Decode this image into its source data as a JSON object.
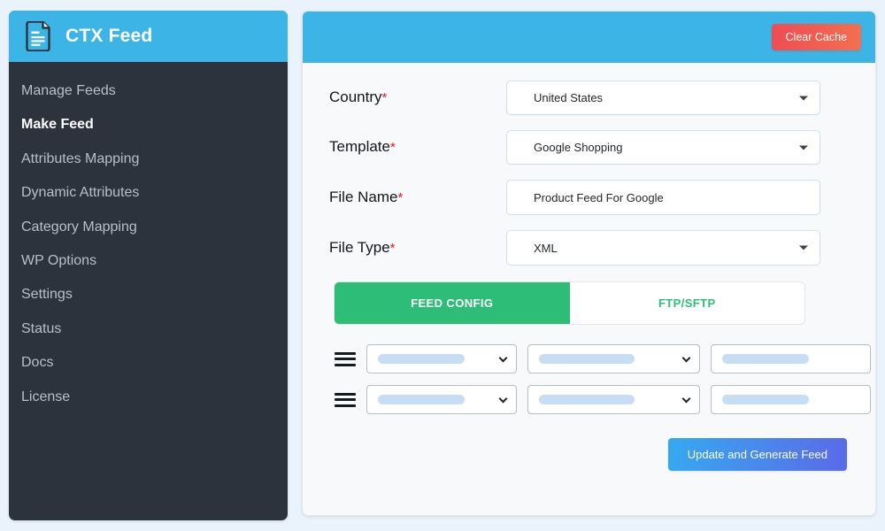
{
  "sidebar": {
    "brand": {
      "title": "CTX Feed",
      "icon": "document-feed-icon"
    },
    "items": [
      {
        "label": "Manage Feeds",
        "active": false
      },
      {
        "label": "Make Feed",
        "active": true
      },
      {
        "label": "Attributes Mapping",
        "active": false
      },
      {
        "label": "Dynamic Attributes",
        "active": false
      },
      {
        "label": "Category Mapping",
        "active": false
      },
      {
        "label": "WP Options",
        "active": false
      },
      {
        "label": "Settings",
        "active": false
      },
      {
        "label": "Status",
        "active": false
      },
      {
        "label": "Docs",
        "active": false
      },
      {
        "label": "License",
        "active": false
      }
    ]
  },
  "header": {
    "clear_cache_label": "Clear Cache",
    "bar_color": "#3cb4e5",
    "clear_cache_color": "#ef4b54"
  },
  "form": {
    "required_mark": "*",
    "fields": [
      {
        "label": "Country",
        "value": "United States",
        "type": "select",
        "name": "country-select"
      },
      {
        "label": "Template",
        "value": "Google Shopping",
        "type": "select",
        "name": "template-select"
      },
      {
        "label": "File Name",
        "value": "Product Feed For Google",
        "type": "text",
        "name": "file-name-input"
      },
      {
        "label": "File Type",
        "value": "XML",
        "type": "select",
        "name": "file-type-select"
      }
    ]
  },
  "tabs": [
    {
      "label": "FEED CONFIG",
      "active": true,
      "name": "tab-feed-config"
    },
    {
      "label": "FTP/SFTP",
      "active": false,
      "name": "tab-ftp-sftp"
    }
  ],
  "tab_colors": {
    "active_bg": "#2ebd77",
    "inactive_text": "#2ebd7a"
  },
  "mapping_rows": [
    {
      "col1": "",
      "col2": "",
      "col3": "",
      "loading": true
    },
    {
      "col1": "",
      "col2": "",
      "col3": "",
      "loading": true
    }
  ],
  "footer": {
    "generate_label": "Update and Generate Feed",
    "generate_color": "#5a6ae8"
  }
}
